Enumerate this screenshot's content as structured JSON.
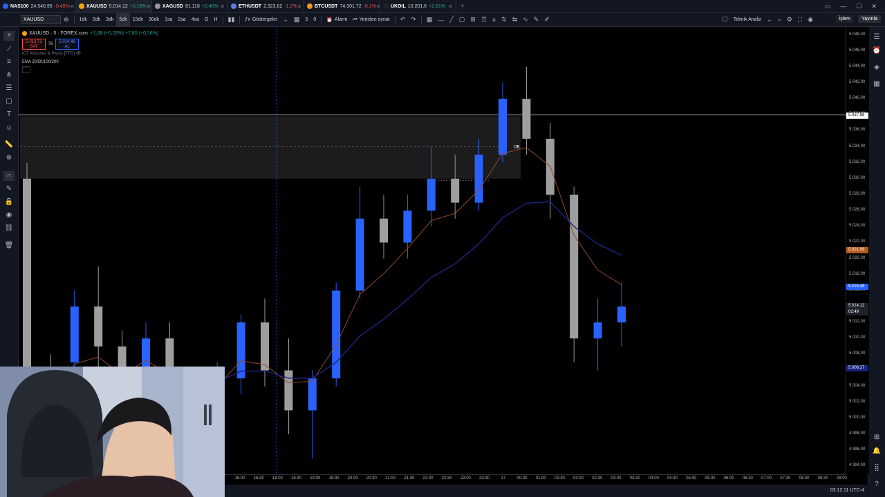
{
  "tabs": [
    {
      "symbol": "NAS100",
      "value": "24.540,95",
      "change": "-0.45%",
      "dir": "down",
      "color": "#2962ff",
      "active": false
    },
    {
      "symbol": "XAUUSD",
      "value": "5.014,12",
      "change": "+0.16%",
      "dir": "up",
      "color": "#f7a600",
      "active": true
    },
    {
      "symbol": "XAGUSD",
      "value": "81,118",
      "change": "+0.45%",
      "dir": "up",
      "color": "#9598a1",
      "active": false
    },
    {
      "symbol": "ETHUSDT",
      "value": "2.323,62",
      "change": "-1.2%",
      "dir": "down",
      "color": "#627eea",
      "active": false
    },
    {
      "symbol": "BTCUSDT",
      "value": "74.301,72",
      "change": "-0.1%",
      "dir": "down",
      "color": "#f7931a",
      "active": false
    },
    {
      "symbol": "UKOIL",
      "value": "10.201,6",
      "change": "+2.81%",
      "dir": "up",
      "color": "#1e222d",
      "active": false
    }
  ],
  "toolbar": {
    "symbol": "XAUUSD",
    "intervals": [
      "1dk",
      "2dk",
      "3dk",
      "5dk",
      "15dk",
      "30dk",
      "1sa",
      "2sa",
      "4sa",
      "G",
      "H"
    ],
    "active_interval": "5dk",
    "indicators_label": "Göstergeler",
    "alarm_label": "Alarm",
    "replay_label": "Yeniden oynat",
    "tech_analysis_label": "Teknik Analiz",
    "trade_label": "İşlem",
    "publish_label": "Yayınla",
    "indicator_count_a": "5",
    "indicator_count_b": "0"
  },
  "legend": {
    "title": "XAUUSD · 5 · FOREX.com",
    "ohlc": "+1,68 (+0,03%) +7,85 (+0,16%)",
    "sell_price": "5.013,72",
    "sell_label": "SAT",
    "spread": "76",
    "buy_price": "5.014,48",
    "buy_label": "AL",
    "indicator1": "ICT Killzones & Pivots [TFO]",
    "indicator2": "EMA 20/50/100/200"
  },
  "chart_data": {
    "type": "candlestick",
    "symbol": "XAUUSD",
    "interval": "5",
    "ylim": [
      4993,
      5049
    ],
    "ob_label": "OB",
    "horizontal_line": 5037.98,
    "box": {
      "top": 5037.8,
      "bottom": 5030.0
    },
    "close": 5014.12,
    "candles": [
      {
        "t": "15:00",
        "o": 5030,
        "h": 5032,
        "c": 5004,
        "l": 5001
      },
      {
        "t": "15:30",
        "o": 5004,
        "h": 5008,
        "c": 4999,
        "l": 4996
      },
      {
        "t": "16:00",
        "o": 5007,
        "h": 5016,
        "c": 5014,
        "l": 5004
      },
      {
        "t": "16:30",
        "o": 5014,
        "h": 5019,
        "c": 5009,
        "l": 5005
      },
      {
        "t": "17:00",
        "o": 5009,
        "h": 5011,
        "c": 5002,
        "l": 4998
      },
      {
        "t": "17:30",
        "o": 5002,
        "h": 5012,
        "c": 5010,
        "l": 4999
      },
      {
        "t": "18:00",
        "o": 5010,
        "h": 5012,
        "c": 5003,
        "l": 4999
      },
      {
        "t": "18:30",
        "o": 5003,
        "h": 5006,
        "c": 5000,
        "l": 4998
      },
      {
        "t": "19:00",
        "o": 5000,
        "h": 5007,
        "c": 5005,
        "l": 4999
      },
      {
        "t": "19:30",
        "o": 5005,
        "h": 5013,
        "c": 5012,
        "l": 5003
      },
      {
        "t": "20:00",
        "o": 5012,
        "h": 5015,
        "c": 5006,
        "l": 5004
      },
      {
        "t": "20:30",
        "o": 5006,
        "h": 5010,
        "c": 5001,
        "l": 4998
      },
      {
        "t": "21:00",
        "o": 5001,
        "h": 5006,
        "c": 5005,
        "l": 4995
      },
      {
        "t": "21:30",
        "o": 5005,
        "h": 5017,
        "c": 5016,
        "l": 5004
      },
      {
        "t": "22:00",
        "o": 5016,
        "h": 5029,
        "c": 5025,
        "l": 5015
      },
      {
        "t": "22:30",
        "o": 5025,
        "h": 5028,
        "c": 5022,
        "l": 5020
      },
      {
        "t": "23:00",
        "o": 5022,
        "h": 5028,
        "c": 5026,
        "l": 5020
      },
      {
        "t": "23:30",
        "o": 5026,
        "h": 5034,
        "c": 5030,
        "l": 5024
      },
      {
        "t": "00:00",
        "o": 5030,
        "h": 5033,
        "c": 5027,
        "l": 5025
      },
      {
        "t": "00:30",
        "o": 5027,
        "h": 5035,
        "c": 5033,
        "l": 5026
      },
      {
        "t": "01:00",
        "o": 5033,
        "h": 5042,
        "c": 5040,
        "l": 5032
      },
      {
        "t": "01:30",
        "o": 5040,
        "h": 5044,
        "c": 5035,
        "l": 5033
      },
      {
        "t": "02:00",
        "o": 5035,
        "h": 5037,
        "c": 5028,
        "l": 5025
      },
      {
        "t": "02:30",
        "o": 5028,
        "h": 5029,
        "c": 5010,
        "l": 5007
      },
      {
        "t": "03:00",
        "o": 5010,
        "h": 5015,
        "c": 5012,
        "l": 5006
      },
      {
        "t": "03:10",
        "o": 5012,
        "h": 5017,
        "c": 5014,
        "l": 5009
      }
    ]
  },
  "price_axis": {
    "labels": [
      "5.048,00",
      "5.046,00",
      "5.044,00",
      "5.042,00",
      "5.040,00",
      "5.038,00",
      "5.036,00",
      "5.034,00",
      "5.032,00",
      "5.030,00",
      "5.028,00",
      "5.026,00",
      "5.024,00",
      "5.022,00",
      "5.020,00",
      "5.018,00",
      "5.016,00",
      "5.014,00",
      "5.012,00",
      "5.010,00",
      "5.008,00",
      "5.006,00",
      "5.004,00",
      "5.002,00",
      "5.000,00",
      "4.998,00",
      "4.996,00",
      "4.994,00"
    ],
    "tag_hline": "5.037,98",
    "tag_ema_orange": "5.021,09",
    "tag_ema_blue": "5.016,48",
    "tag_last": "5.014,12",
    "tag_countdown": "02:49",
    "tag_low_blue": "5.006,27"
  },
  "time_axis": {
    "labels": [
      "16:00",
      "16:30",
      "18:00",
      "18:30",
      "19:00",
      "19:30",
      "20:00",
      "20:30",
      "21:00",
      "21:30",
      "22:00",
      "22:30",
      "23:00",
      "23:30",
      "17",
      "00:30",
      "01:00",
      "01:30",
      "02:00",
      "02:30",
      "03:00",
      "03:30",
      "04:00",
      "04:30",
      "05:00",
      "05:30",
      "06:00",
      "06:30",
      "07:00",
      "07:30",
      "08:00",
      "08:30",
      "09:00"
    ]
  },
  "status": {
    "clock": "03:12:11 UTC-4"
  },
  "colors": {
    "bull": "#2962ff",
    "bear": "#9e9e9e",
    "ema_orange": "#8d4a2a",
    "ema_blue": "#1a237e",
    "hline": "#ffffff"
  }
}
